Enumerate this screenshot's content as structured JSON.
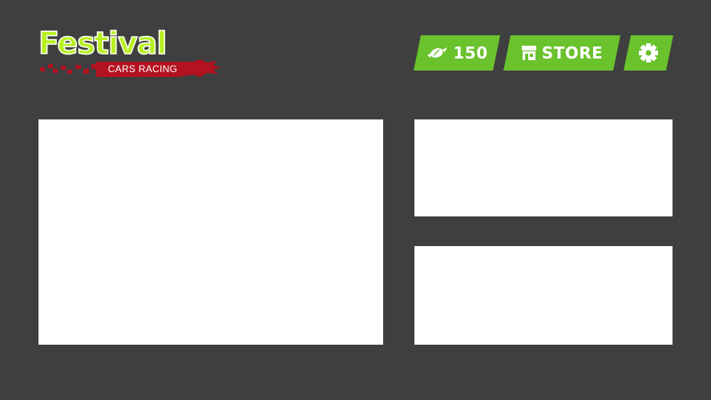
{
  "logo": {
    "title": "Festival",
    "subtitle": "CARS RACING",
    "title_color": "#b6f01f",
    "splat_color": "#b3121f"
  },
  "hud": {
    "coins": {
      "icon": "candy-icon",
      "value": "150"
    },
    "store": {
      "icon": "store-icon",
      "label": "STORE"
    },
    "settings": {
      "icon": "gear-icon"
    },
    "button_color": "#6ac22d"
  },
  "panels": {
    "main": {},
    "top_right": {},
    "bottom_right": {}
  },
  "colors": {
    "background": "#3f3f3f",
    "panel": "#ffffff"
  }
}
